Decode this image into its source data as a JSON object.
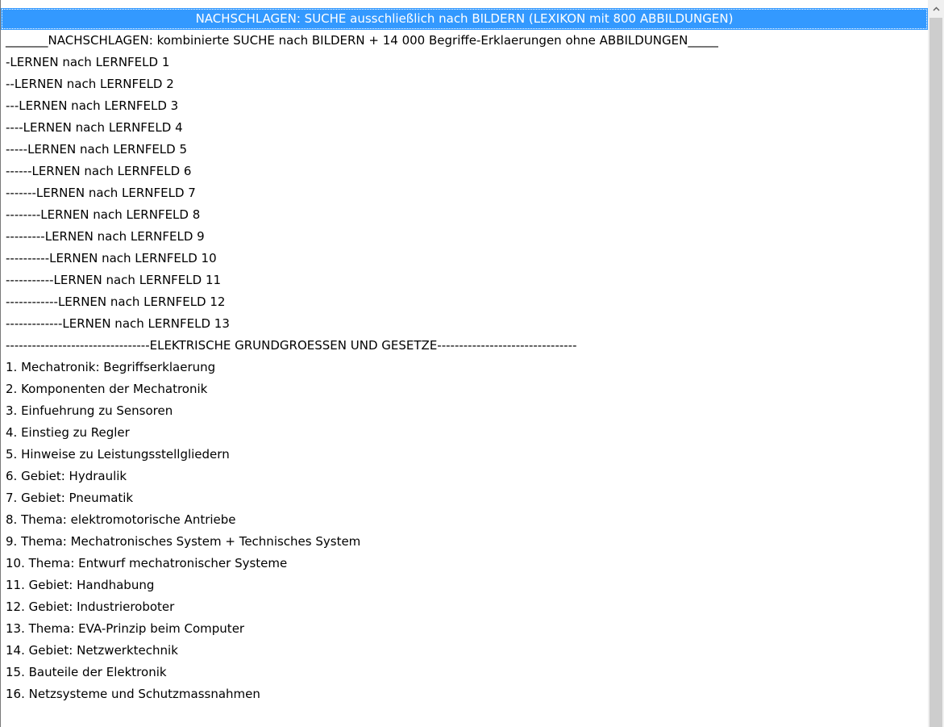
{
  "listbox": {
    "items": [
      {
        "label": "NACHSCHLAGEN: SUCHE ausschließlich nach BILDERN (LEXIKON mit 800 ABBILDUNGEN)",
        "selected": true
      },
      {
        "label": "_______NACHSCHLAGEN: kombinierte SUCHE nach BILDERN + 14 000 Begriffe-Erklaerungen ohne ABBILDUNGEN_____"
      },
      {
        "label": "-LERNEN nach LERNFELD 1"
      },
      {
        "label": "--LERNEN nach LERNFELD 2"
      },
      {
        "label": "---LERNEN nach LERNFELD 3"
      },
      {
        "label": "----LERNEN nach LERNFELD 4"
      },
      {
        "label": "-----LERNEN nach LERNFELD 5"
      },
      {
        "label": "------LERNEN nach LERNFELD 6"
      },
      {
        "label": "-------LERNEN nach LERNFELD 7"
      },
      {
        "label": "--------LERNEN nach LERNFELD 8"
      },
      {
        "label": "---------LERNEN nach LERNFELD 9"
      },
      {
        "label": "----------LERNEN nach LERNFELD 10"
      },
      {
        "label": "-----------LERNEN nach LERNFELD 11"
      },
      {
        "label": "------------LERNEN nach LERNFELD 12"
      },
      {
        "label": "-------------LERNEN nach LERNFELD 13"
      },
      {
        "label": "---------------------------------ELEKTRISCHE GRUNDGROESSEN UND GESETZE--------------------------------"
      },
      {
        "label": "1. Mechatronik: Begriffserklaerung"
      },
      {
        "label": "2. Komponenten der Mechatronik"
      },
      {
        "label": "3. Einfuehrung zu Sensoren"
      },
      {
        "label": "4. Einstieg zu Regler"
      },
      {
        "label": "5. Hinweise zu Leistungsstellgliedern"
      },
      {
        "label": "6. Gebiet: Hydraulik"
      },
      {
        "label": "7. Gebiet: Pneumatik"
      },
      {
        "label": "8. Thema: elektromotorische Antriebe"
      },
      {
        "label": "9. Thema: Mechatronisches System + Technisches System"
      },
      {
        "label": "10. Thema: Entwurf mechatronischer Systeme"
      },
      {
        "label": "11. Gebiet: Handhabung"
      },
      {
        "label": "12. Gebiet: Industrieroboter"
      },
      {
        "label": "13. Thema: EVA-Prinzip beim Computer"
      },
      {
        "label": "14. Gebiet: Netzwerktechnik"
      },
      {
        "label": "15. Bauteile der Elektronik"
      },
      {
        "label": "16. Netzsysteme und Schutzmassnahmen"
      }
    ]
  },
  "scrollbar": {
    "up_icon": "chevron-up-icon"
  },
  "colors": {
    "selection": "#3399ff",
    "selection_text": "#ffffff",
    "scrollbar_track": "#f0f0f0",
    "scrollbar_thumb": "#cdcdcd"
  }
}
